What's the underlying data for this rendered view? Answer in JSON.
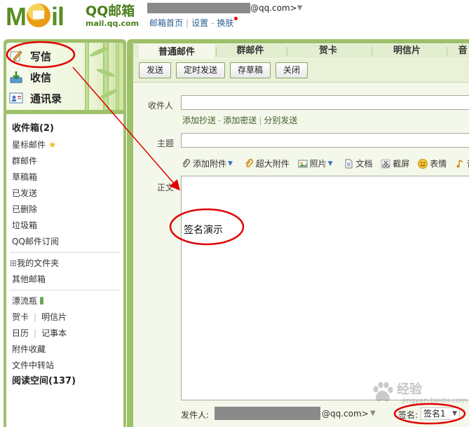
{
  "header": {
    "logo_text": "MOil",
    "brand_name": "QQ邮箱",
    "brand_domain": "mail.qq.com",
    "account_domain": "@qq.com>",
    "links": [
      "邮箱首页",
      "设置",
      "换肤"
    ]
  },
  "sidebar": {
    "quick_actions": [
      {
        "label": "写信",
        "icon": "compose-icon"
      },
      {
        "label": "收信",
        "icon": "inbox-download-icon"
      },
      {
        "label": "通讯录",
        "icon": "contacts-icon"
      }
    ],
    "folders": [
      {
        "label": "收件箱(2)",
        "bold": true
      },
      {
        "label": "星标邮件",
        "star": true
      },
      {
        "label": "群邮件"
      },
      {
        "label": "草稿箱"
      },
      {
        "label": "已发送"
      },
      {
        "label": "已删除"
      },
      {
        "label": "垃圾箱"
      },
      {
        "label": "QQ邮件订阅"
      }
    ],
    "my_folders": "我的文件夹",
    "my_folders_toggle": "⊞",
    "other_mail": "其他邮箱",
    "apps": {
      "drift_bottle": "漂流瓶",
      "card": "贺卡",
      "postcard": "明信片",
      "calendar": "日历",
      "notebook": "记事本",
      "attachments": "附件收藏",
      "file_transfer": "文件中转站",
      "reading_space": "阅读空间(137)"
    }
  },
  "compose": {
    "tabs": [
      "普通邮件",
      "群邮件",
      "贺卡",
      "明信片",
      "音"
    ],
    "buttons": {
      "send": "发送",
      "scheduled": "定时发送",
      "save_draft": "存草稿",
      "close": "关闭"
    },
    "recipient_label": "收件人",
    "recipient_links": [
      "添加抄送",
      "添加密送",
      "分别发送"
    ],
    "subject_label": "主题",
    "toolbar": {
      "attach": "添加附件",
      "big_attach": "超大附件",
      "photo": "照片",
      "doc": "文档",
      "screenshot": "截屏",
      "emoji": "表情",
      "music": "音"
    },
    "body_label": "正文",
    "body_text": "签名演示",
    "sender_label": "发件人:",
    "sender_domain": "@qq.com>",
    "signature_label": "签名:",
    "signature_value": "签名1"
  },
  "colors": {
    "frame_green": "#9ec06a",
    "annotation_red": "#e00000",
    "link_blue": "#2b5f92"
  },
  "watermark": {
    "text": "经验",
    "url": "jingyan.baidu.com"
  }
}
